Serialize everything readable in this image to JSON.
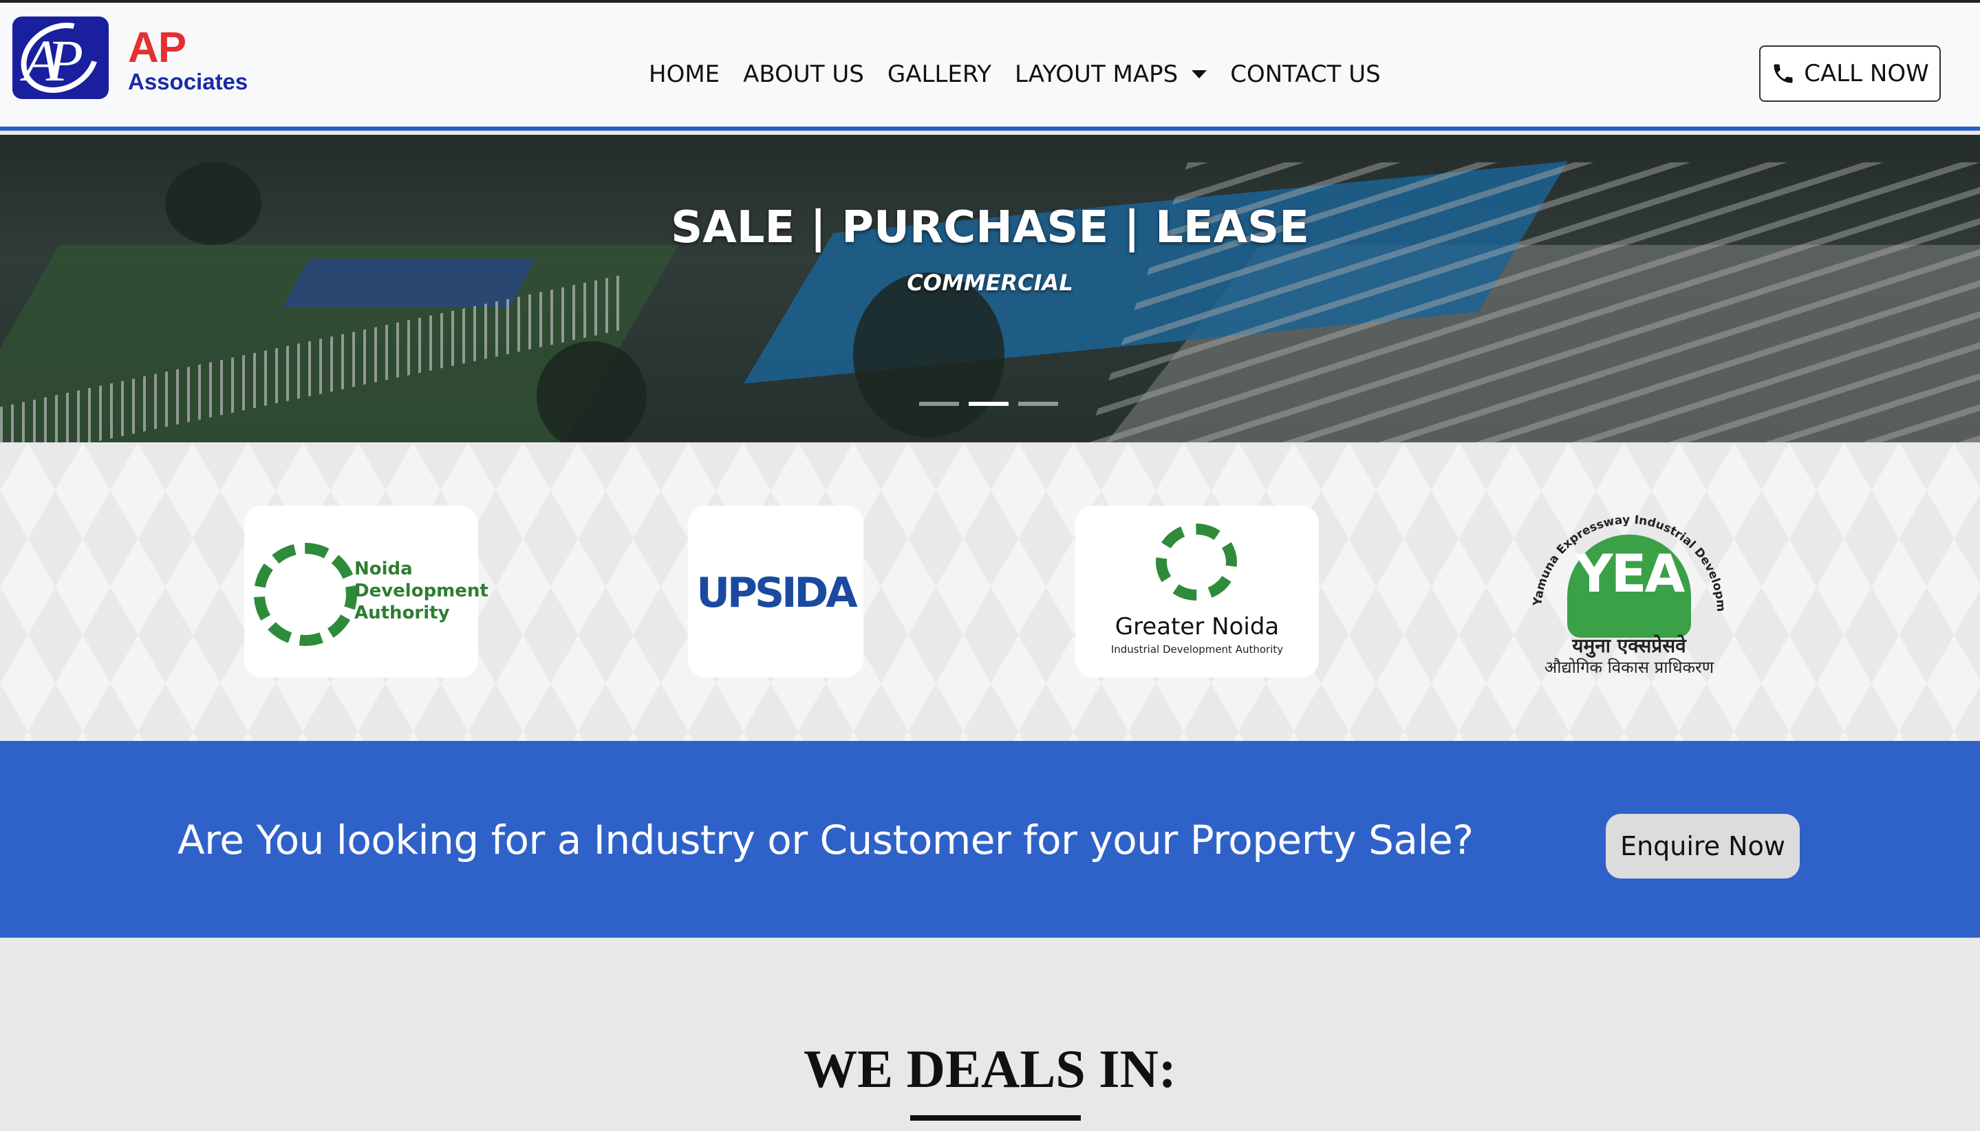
{
  "brand": {
    "logo_letters": "AP",
    "name_short": "AP",
    "name_long": "Associates"
  },
  "nav": {
    "items": [
      {
        "label": "HOME"
      },
      {
        "label": "ABOUT US"
      },
      {
        "label": "GALLERY"
      },
      {
        "label": "LAYOUT MAPS",
        "has_dropdown": true
      },
      {
        "label": "CONTACT US"
      }
    ],
    "call_button": "CALL NOW",
    "call_icon": "phone-icon"
  },
  "hero": {
    "title": "SALE | PURCHASE | LEASE",
    "subtitle": "COMMERCIAL",
    "slides_total": 3,
    "active_slide": 2
  },
  "authorities": {
    "noida": {
      "line1": "Noida",
      "line2": "Development",
      "line3": "Authority"
    },
    "upsida": {
      "name": "UPSIDA"
    },
    "greater_noida": {
      "title": "Greater Noida",
      "subtitle": "Industrial Development Authority"
    },
    "yea": {
      "arc_text": "Yamuna Expressway Industrial Development Authority",
      "initials": "YEA",
      "hindi_line1": "यमुना एक्सप्रेसवे",
      "hindi_line2": "औद्योगिक विकास प्राधिकरण"
    }
  },
  "cta": {
    "text": "Are You looking for a Industry or Customer for your Property Sale?",
    "button": "Enquire Now"
  },
  "deals": {
    "title": "WE DEALS IN:"
  },
  "colors": {
    "brand_blue": "#2f62c8",
    "logo_navy": "#1b2aa6",
    "logo_red": "#e43030",
    "authority_green": "#2e8b3a"
  }
}
